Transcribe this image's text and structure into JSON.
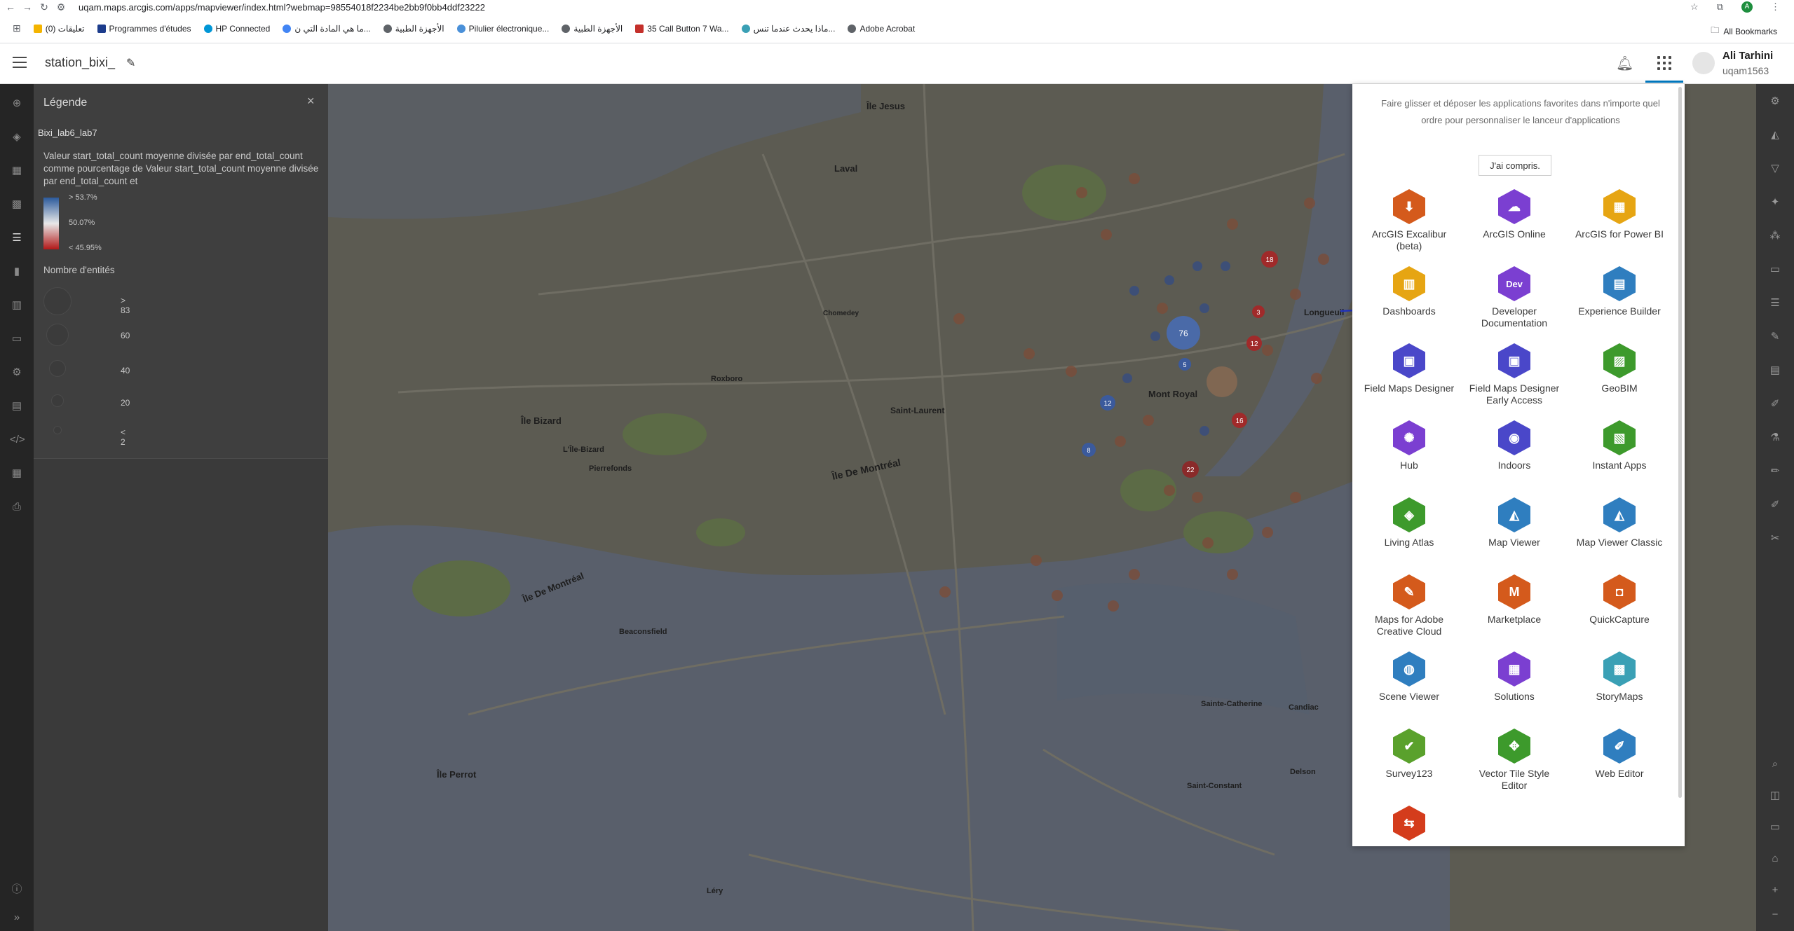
{
  "browser": {
    "url": "uqam.maps.arcgis.com/apps/mapviewer/index.html?webmap=98554018f2234be2bb9f0bb4ddf23222",
    "profile_initial": "A",
    "bookmarks": [
      {
        "label": "تعليقات (0)",
        "color": "#f4b400"
      },
      {
        "label": "Programmes d'études",
        "color": "#1c3c8c"
      },
      {
        "label": "HP Connected",
        "color": "#0096d6"
      },
      {
        "label": "ما هي المادة التي ن...",
        "color": "#4285f4"
      },
      {
        "label": "الأجهزة الطبية",
        "color": "#5f6368"
      },
      {
        "label": "Pilulier électronique...",
        "color": "#4a90d9"
      },
      {
        "label": "الأجهزة الطبية",
        "color": "#5f6368"
      },
      {
        "label": "35 Call Button 7 Wa...",
        "color": "#c4302b"
      },
      {
        "label": "ماذا يحدث عندما تنس...",
        "color": "#3aa0b5"
      },
      {
        "label": "Adobe Acrobat",
        "color": "#5f6368"
      }
    ],
    "all_bookmarks": "All Bookmarks"
  },
  "header": {
    "map_title": "station_bixi_",
    "user_name": "Ali Tarhini",
    "user_id": "uqam1563"
  },
  "legend": {
    "title": "Légende",
    "layer_name": "Bixi_lab6_lab7",
    "description": "Valeur start_total_count moyenne divisée par end_total_count comme pourcentage de Valeur start_total_count moyenne divisée par end_total_count et",
    "ramp_high": "> 53.7%",
    "ramp_mid": "50.07%",
    "ramp_low": "< 45.95%",
    "count_title": "Nombre d'entités",
    "size_classes": [
      "> 83",
      "60",
      "40",
      "20",
      "< 2"
    ]
  },
  "launcher": {
    "hint": "Faire glisser et déposer les applications favorites dans n'importe quel ordre pour personnaliser le lanceur d'applications",
    "got_it": "J'ai compris.",
    "apps": [
      {
        "name": "ArcGIS Excalibur (beta)",
        "color": "#d45a1c",
        "icon": "excalibur-icon",
        "glyph": "⬇"
      },
      {
        "name": "ArcGIS Online",
        "color": "#7b3fd1",
        "icon": "online-icon",
        "glyph": "☁"
      },
      {
        "name": "ArcGIS for Power BI",
        "color": "#e6a513",
        "icon": "powerbi-icon",
        "glyph": "▦"
      },
      {
        "name": "Dashboards",
        "color": "#e6a513",
        "icon": "dashboards-icon",
        "glyph": "▥"
      },
      {
        "name": "Developer Documentation",
        "color": "#7b3fd1",
        "icon": "dev-icon",
        "glyph": "Dev"
      },
      {
        "name": "Experience Builder",
        "color": "#2f7ebf",
        "icon": "experience-builder-icon",
        "glyph": "▤"
      },
      {
        "name": "Field Maps Designer",
        "color": "#4a47c9",
        "icon": "field-maps-designer-icon",
        "glyph": "▣"
      },
      {
        "name": "Field Maps Designer Early Access",
        "color": "#4a47c9",
        "icon": "field-maps-ea-icon",
        "glyph": "▣"
      },
      {
        "name": "GeoBIM",
        "color": "#3d9a2c",
        "icon": "geobim-icon",
        "glyph": "▨"
      },
      {
        "name": "Hub",
        "color": "#7b3fd1",
        "icon": "hub-icon",
        "glyph": "✺"
      },
      {
        "name": "Indoors",
        "color": "#4a47c9",
        "icon": "indoors-icon",
        "glyph": "◉"
      },
      {
        "name": "Instant Apps",
        "color": "#3d9a2c",
        "icon": "instant-apps-icon",
        "glyph": "▧"
      },
      {
        "name": "Living Atlas",
        "color": "#3d9a2c",
        "icon": "living-atlas-icon",
        "glyph": "◈"
      },
      {
        "name": "Map Viewer",
        "color": "#2f7ebf",
        "icon": "map-viewer-icon",
        "glyph": "◭"
      },
      {
        "name": "Map Viewer Classic",
        "color": "#2f7ebf",
        "icon": "map-viewer-classic-icon",
        "glyph": "◭"
      },
      {
        "name": "Maps for Adobe Creative Cloud",
        "color": "#d45a1c",
        "icon": "adobe-maps-icon",
        "glyph": "✎"
      },
      {
        "name": "Marketplace",
        "color": "#d45a1c",
        "icon": "marketplace-icon",
        "glyph": "M"
      },
      {
        "name": "QuickCapture",
        "color": "#d45a1c",
        "icon": "quickcapture-icon",
        "glyph": "◘"
      },
      {
        "name": "Scene Viewer",
        "color": "#2f7ebf",
        "icon": "scene-viewer-icon",
        "glyph": "◍"
      },
      {
        "name": "Solutions",
        "color": "#7b3fd1",
        "icon": "solutions-icon",
        "glyph": "▦"
      },
      {
        "name": "StoryMaps",
        "color": "#3aa0b5",
        "icon": "storymaps-icon",
        "glyph": "▩"
      },
      {
        "name": "Survey123",
        "color": "#5aa12c",
        "icon": "survey123-icon",
        "glyph": "✔"
      },
      {
        "name": "Vector Tile Style Editor",
        "color": "#3d9a2c",
        "icon": "vector-tile-icon",
        "glyph": "✥"
      },
      {
        "name": "Web Editor",
        "color": "#2f7ebf",
        "icon": "web-editor-icon",
        "glyph": "✐"
      },
      {
        "name": "",
        "color": "#d43c1c",
        "icon": "workflow-icon",
        "glyph": "⇆"
      }
    ]
  },
  "map": {
    "place_labels": [
      {
        "text": "Île Jesus"
      },
      {
        "text": "Laval"
      },
      {
        "text": "Roxboro"
      },
      {
        "text": "Saint-Laurent"
      },
      {
        "text": "Île Bizard"
      },
      {
        "text": "L'Île-Bizard"
      },
      {
        "text": "Pierrefonds"
      },
      {
        "text": "Île De Montréal"
      },
      {
        "text": "Île De Montréal"
      },
      {
        "text": "Mont Royal"
      },
      {
        "text": "Beaconsfield"
      },
      {
        "text": "Île Perrot"
      },
      {
        "text": "Sainte-Catherine"
      },
      {
        "text": "Saint-Constant"
      },
      {
        "text": "Candiac"
      },
      {
        "text": "Delson"
      },
      {
        "text": "Léry"
      },
      {
        "text": "Chomedey"
      },
      {
        "text": "Longueuil"
      }
    ],
    "clusters": [
      {
        "label": "76"
      },
      {
        "label": "18"
      },
      {
        "label": "12"
      },
      {
        "label": "12"
      },
      {
        "label": "16"
      },
      {
        "label": "22"
      },
      {
        "label": "5"
      },
      {
        "label": "3"
      },
      {
        "label": "8"
      }
    ]
  }
}
